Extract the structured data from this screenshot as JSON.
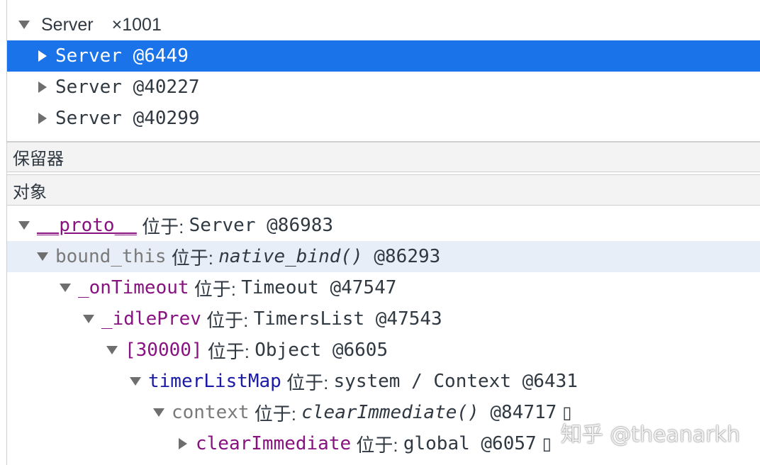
{
  "constructors_panel": {
    "group": {
      "name": "Server",
      "count": "×1001"
    },
    "instances": [
      {
        "name": "Server",
        "id": "@6449"
      },
      {
        "name": "Server",
        "id": "@40227"
      },
      {
        "name": "Server",
        "id": "@40299"
      }
    ]
  },
  "retainers_tab": {
    "label": "保留器"
  },
  "object_header": {
    "label": "对象"
  },
  "retainer_tree": [
    {
      "key": "__proto__",
      "sep": " 位于: ",
      "type": "Server",
      "id": "@86983"
    },
    {
      "key": "bound_this",
      "sep": " 位于: ",
      "type": "native_bind()",
      "id": "@86293"
    },
    {
      "key": "_onTimeout",
      "sep": " 位于: ",
      "type": "Timeout",
      "id": "@47547"
    },
    {
      "key": "_idlePrev",
      "sep": " 位于: ",
      "type": "TimersList",
      "id": "@47543"
    },
    {
      "key": "[30000]",
      "sep": " 位于: ",
      "type": "Object",
      "id": "@6605"
    },
    {
      "key": "timerListMap",
      "sep": " 位于: ",
      "type": "system / Context",
      "id": "@6431"
    },
    {
      "key": "context",
      "sep": " 位于: ",
      "type": "clearImmediate()",
      "id": "@84717",
      "marker": "▯"
    },
    {
      "key": "clearImmediate",
      "sep": " 位于: ",
      "type": "global",
      "id": "@6057",
      "marker": "▯"
    }
  ],
  "watermark": {
    "text": "知乎 @theanarkh"
  }
}
